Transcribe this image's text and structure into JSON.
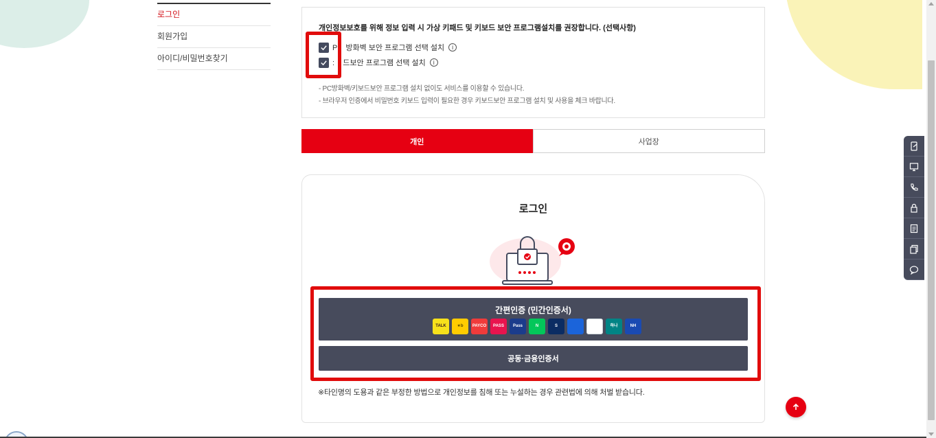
{
  "subnav": {
    "items": [
      {
        "label": "로그인"
      },
      {
        "label": "회원가입"
      },
      {
        "label": "아이디/비밀번호찾기"
      }
    ]
  },
  "security": {
    "title": "개인정보보호를 위해 정보 입력 시 가상 키패드 및 키보드 보안 프로그램설치를 권장합니다. (선택사항)",
    "option1": "P    방화벽 보안 프로그램 선택 설치",
    "option2": ":    드보안 프로그램 선택 설치",
    "info_glyph": "i",
    "notes": [
      "-  PC방화벽/키보드보안 프로그램 설치 없이도 서비스를 이용할 수 있습니다.",
      "-  브라우저 인증에서 비밀번호 키보드 입력이 필요한 경우 키보드보안 프로그램 설치 및 사용을 체크 바랍니다."
    ]
  },
  "tabs": [
    {
      "label": "개인"
    },
    {
      "label": "사업장"
    }
  ],
  "login": {
    "title": "로그인",
    "simple_auth_label": "간편인증 (민간인증서)",
    "cert_label": "공동·금융인증서",
    "warning": "※타인명의 도용과 같은 부정한 방법으로 개인정보를 침해 또는 누설하는 경우 관련법에 의해 처벌 받습니다."
  },
  "providers": [
    {
      "icon": "kakao-icon",
      "text": "TALK",
      "bg": "#f7e11b",
      "fg": "#3a1d1d"
    },
    {
      "icon": "kb-icon",
      "text": "★b",
      "bg": "#ffcc00",
      "fg": "#5a4a00"
    },
    {
      "icon": "payco-icon",
      "text": "PAYCO",
      "bg": "#ef3b3b",
      "fg": "#ffffff"
    },
    {
      "icon": "pass-icon",
      "text": "PASS",
      "bg": "#e8144e",
      "fg": "#ffffff"
    },
    {
      "icon": "samsung-pass-icon",
      "text": "Pass",
      "bg": "#1b3c8c",
      "fg": "#ffffff"
    },
    {
      "icon": "naver-icon",
      "text": "N",
      "bg": "#03c75a",
      "fg": "#ffffff"
    },
    {
      "icon": "shinhan-icon",
      "text": "S",
      "bg": "#0b2c63",
      "fg": "#ffffff"
    },
    {
      "icon": "toss-icon",
      "text": "",
      "bg": "#1b64da",
      "fg": "#ffffff"
    },
    {
      "icon": "banksalad-icon",
      "text": "",
      "bg": "#ffffff",
      "fg": "#00c08b"
    },
    {
      "icon": "hana-icon",
      "text": "하나",
      "bg": "#008485",
      "fg": "#ffffff"
    },
    {
      "icon": "nh-icon",
      "text": "NH",
      "bg": "#1a4ab2",
      "fg": "#ffffff"
    }
  ],
  "quick_menu": [
    {
      "icon": "phone-doc-icon"
    },
    {
      "icon": "monitor-icon"
    },
    {
      "icon": "call-icon"
    },
    {
      "icon": "lock-icon"
    },
    {
      "icon": "document-icon"
    },
    {
      "icon": "copy-icon"
    },
    {
      "icon": "chat-icon"
    }
  ],
  "colors": {
    "accent": "#e60012",
    "dark_button": "#474b5c",
    "annotation_red": "#e10c0c"
  }
}
